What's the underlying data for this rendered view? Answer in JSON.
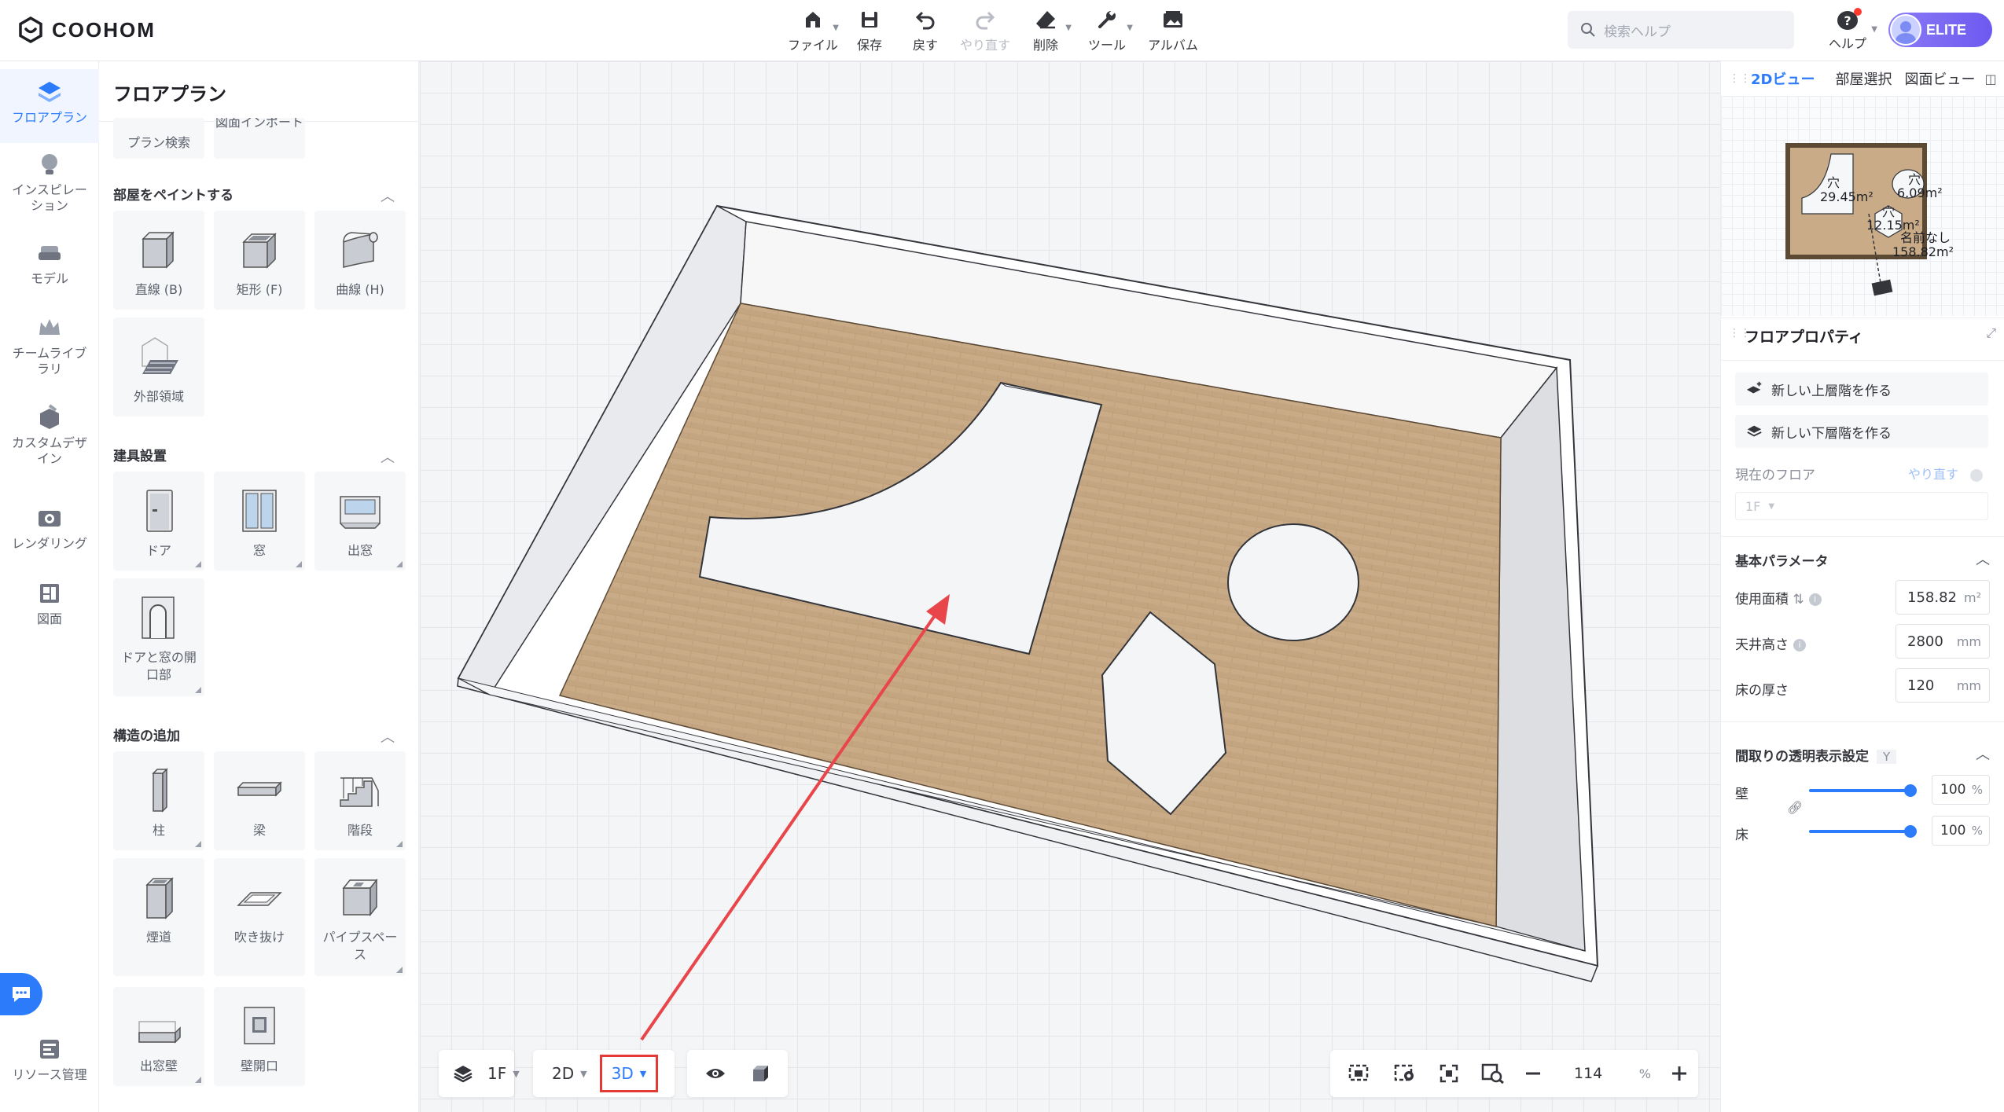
{
  "app": {
    "brand": "COOHOM"
  },
  "toolbar": {
    "file": "ファイル",
    "save": "保存",
    "undo": "戻す",
    "redo": "やり直す",
    "delete": "削除",
    "tools": "ツール",
    "album": "アルバム"
  },
  "search": {
    "placeholder": "検索ヘルプ"
  },
  "help": {
    "label": "ヘルプ"
  },
  "account": {
    "badge": "ELITE"
  },
  "leftnav": {
    "items": [
      {
        "label": "フロアプラン",
        "icon": "floorplan-icon"
      },
      {
        "label": "インスピレーション",
        "icon": "lightbulb-icon"
      },
      {
        "label": "モデル",
        "icon": "sofa-icon"
      },
      {
        "label": "チームライブラリ",
        "icon": "crown-icon"
      },
      {
        "label": "カスタムデザイン",
        "icon": "custom-design-icon"
      },
      {
        "label": "レンダリング",
        "icon": "camera-icon"
      },
      {
        "label": "図面",
        "icon": "drawing-icon"
      },
      {
        "label": "リソース管理",
        "icon": "resource-icon"
      }
    ]
  },
  "panel": {
    "title": "フロアプラン",
    "top_tiles": [
      "プラン検索",
      "図面インポート"
    ],
    "sections": [
      {
        "title": "部屋をペイントする",
        "items": [
          "直線 (B)",
          "矩形 (F)",
          "曲線 (H)",
          "外部領域"
        ]
      },
      {
        "title": "建具設置",
        "items": [
          "ドア",
          "窓",
          "出窓",
          "ドアと窓の開口部"
        ]
      },
      {
        "title": "構造の追加",
        "items": [
          "柱",
          "梁",
          "階段",
          "煙道",
          "吹き抜け",
          "パイプスペース",
          "出窓壁",
          "壁開口"
        ]
      }
    ]
  },
  "canvas_controls": {
    "floor": "1F",
    "view2d": "2D",
    "view3d": "3D",
    "zoom": "114",
    "zoom_unit": "%"
  },
  "rightpanel": {
    "tabs": [
      "2Dビュー",
      "部屋選択",
      "図面ビュー"
    ],
    "minimap_labels": [
      {
        "name": "穴",
        "area": "29.45m²"
      },
      {
        "name": "穴",
        "area": "6.09m²"
      },
      {
        "name": "穴",
        "area": "12.15m²"
      },
      {
        "name": "名前なし",
        "area": "158.82m²"
      }
    ],
    "props_title": "フロアプロパティ",
    "new_upper": "新しい上層階を作る",
    "new_lower": "新しい下層階を作る",
    "current_floor_label": "現在のフロア",
    "redo_link": "やり直す",
    "current_floor_value": "1F",
    "basic_params": "基本パラメータ",
    "area_label": "使用面積",
    "area_value": "158.82",
    "area_unit": "m²",
    "ceiling_label": "天井高さ",
    "ceiling_value": "2800",
    "ceiling_unit": "mm",
    "floor_thick_label": "床の厚さ",
    "floor_thick_value": "120",
    "floor_thick_unit": "mm",
    "transparency_title": "間取りの透明表示設定",
    "transparency_key": "Y",
    "wall_label": "壁",
    "wall_value": "100",
    "floor_label": "床",
    "floor_value": "100",
    "percent": "%"
  },
  "colors": {
    "accent": "#2b7bfa",
    "highlight": "#e53935",
    "floor": "#c9ab87"
  }
}
